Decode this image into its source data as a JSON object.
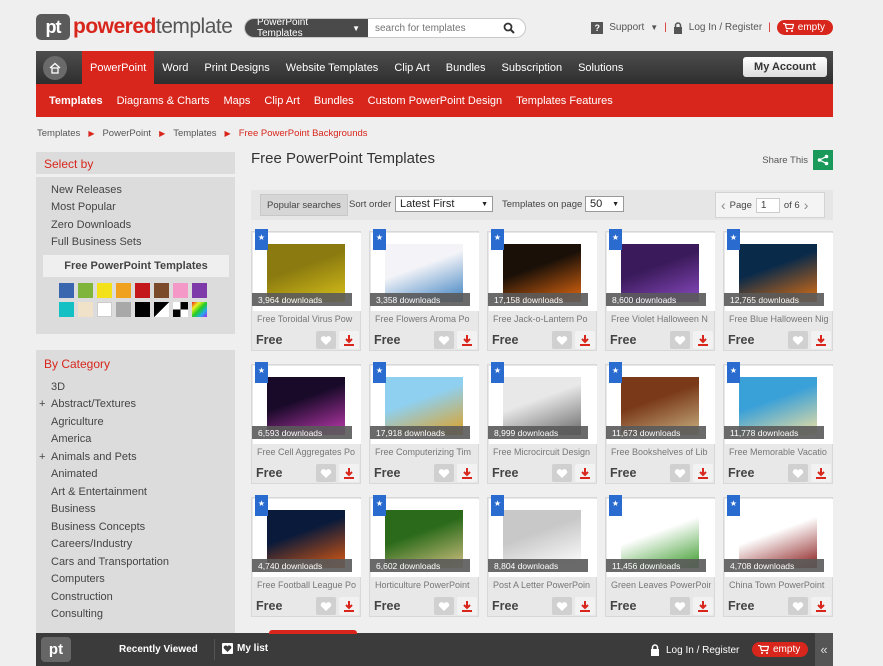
{
  "brand": {
    "mark": "pt",
    "word1": "powered",
    "word2": "template"
  },
  "search": {
    "category": "PowerPoint Templates",
    "placeholder": "search for templates"
  },
  "toplinks": {
    "support": "Support",
    "login": "Log In / Register",
    "cart": "empty"
  },
  "mainnav": {
    "items": [
      "PowerPoint",
      "Word",
      "Print Designs",
      "Website Templates",
      "Clip Art",
      "Bundles",
      "Subscription",
      "Solutions"
    ],
    "account": "My Account"
  },
  "subnav": {
    "items": [
      "Templates",
      "Diagrams & Charts",
      "Maps",
      "Clip Art",
      "Bundles",
      "Custom PowerPoint Design",
      "Templates Features"
    ]
  },
  "breadcrumb": [
    "Templates",
    "PowerPoint",
    "Templates",
    "Free PowerPoint Backgrounds"
  ],
  "select_by": {
    "title": "Select by",
    "links": [
      "New Releases",
      "Most Popular",
      "Zero Downloads",
      "Full Business Sets"
    ],
    "active": "Free PowerPoint Templates",
    "swatches": [
      "#3a66b0",
      "#7fb53a",
      "#f3e21a",
      "#f0a21e",
      "#c4171b",
      "#7a4a2a",
      "#f498c8",
      "#7e3aa8",
      "#13c1c4",
      "#efe2c8",
      "#ffffff",
      "#a8a8a8",
      "#000000",
      "bw",
      "check",
      "rainbow"
    ]
  },
  "by_category": {
    "title": "By Category",
    "items": [
      {
        "label": "3D",
        "plus": false
      },
      {
        "label": "Abstract/Textures",
        "plus": true
      },
      {
        "label": "Agriculture",
        "plus": false
      },
      {
        "label": "America",
        "plus": false
      },
      {
        "label": "Animals and Pets",
        "plus": true
      },
      {
        "label": "Animated",
        "plus": false
      },
      {
        "label": "Art & Entertainment",
        "plus": false
      },
      {
        "label": "Business",
        "plus": false
      },
      {
        "label": "Business Concepts",
        "plus": false
      },
      {
        "label": "Careers/Industry",
        "plus": false
      },
      {
        "label": "Cars and Transportation",
        "plus": false
      },
      {
        "label": "Computers",
        "plus": false
      },
      {
        "label": "Construction",
        "plus": false
      },
      {
        "label": "Consulting",
        "plus": false
      }
    ]
  },
  "content": {
    "title": "Free PowerPoint Templates",
    "share": "Share This",
    "popular": "Popular searches",
    "sort_label": "Sort order",
    "sort_value": "Latest First",
    "per_page_label": "Templates on page",
    "per_page_value": "50",
    "page_label": "Page",
    "page_value": "1",
    "page_of": "of 6"
  },
  "templates": [
    {
      "downloads": "3,964 downloads",
      "name": "Free Toroidal Virus Pow",
      "price": "Free",
      "bg": "#8a7a10",
      "fg": "#d8c018"
    },
    {
      "downloads": "3,358 downloads",
      "name": "Free Flowers Aroma Po",
      "price": "Free",
      "bg": "#f4f4f8",
      "fg": "#3b80c0"
    },
    {
      "downloads": "17,158 downloads",
      "name": "Free Jack-o-Lantern Po",
      "price": "Free",
      "bg": "#1a1008",
      "fg": "#e66a10"
    },
    {
      "downloads": "8,600 downloads",
      "name": "Free Violet Halloween N",
      "price": "Free",
      "bg": "#3a1a5a",
      "fg": "#8a4ac0"
    },
    {
      "downloads": "12,765 downloads",
      "name": "Free Blue Halloween Nig",
      "price": "Free",
      "bg": "#0a2a4a",
      "fg": "#e07010"
    },
    {
      "downloads": "6,593 downloads",
      "name": "Free Cell Aggregates Po",
      "price": "Free",
      "bg": "#1a0a2a",
      "fg": "#c03ab0"
    },
    {
      "downloads": "17,918 downloads",
      "name": "Free Computerizing Tim",
      "price": "Free",
      "bg": "#8fd0f0",
      "fg": "#e0a020"
    },
    {
      "downloads": "8,999 downloads",
      "name": "Free Microcircuit Design",
      "price": "Free",
      "bg": "#e8e8e8",
      "fg": "#6a6a6a"
    },
    {
      "downloads": "11,673 downloads",
      "name": "Free Bookshelves of Lib",
      "price": "Free",
      "bg": "#7a3a1a",
      "fg": "#c8b080"
    },
    {
      "downloads": "11,778 downloads",
      "name": "Free Memorable Vacatio",
      "price": "Free",
      "bg": "#3aa0d8",
      "fg": "#f0e0a0"
    },
    {
      "downloads": "4,740 downloads",
      "name": "Free Football League Po",
      "price": "Free",
      "bg": "#0a1a3a",
      "fg": "#e05a10"
    },
    {
      "downloads": "6,602 downloads",
      "name": "Horticulture PowerPoint",
      "price": "Free",
      "bg": "#2a6a1a",
      "fg": "#d0c080"
    },
    {
      "downloads": "8,804 downloads",
      "name": "Post A Letter PowerPoin",
      "price": "Free",
      "bg": "#c8c8c8",
      "fg": "#ffffff"
    },
    {
      "downloads": "11,456 downloads",
      "name": "Green Leaves PowerPoin",
      "price": "Free",
      "bg": "#ffffff",
      "fg": "#3a9a2a"
    },
    {
      "downloads": "4,708 downloads",
      "name": "China Town PowerPoint",
      "price": "Free",
      "bg": "#ffffff",
      "fg": "#8a1a1a"
    }
  ],
  "footer": {
    "recently_viewed": "Recently Viewed",
    "my_list": "My list",
    "login": "Log In / Register",
    "cart": "empty"
  }
}
